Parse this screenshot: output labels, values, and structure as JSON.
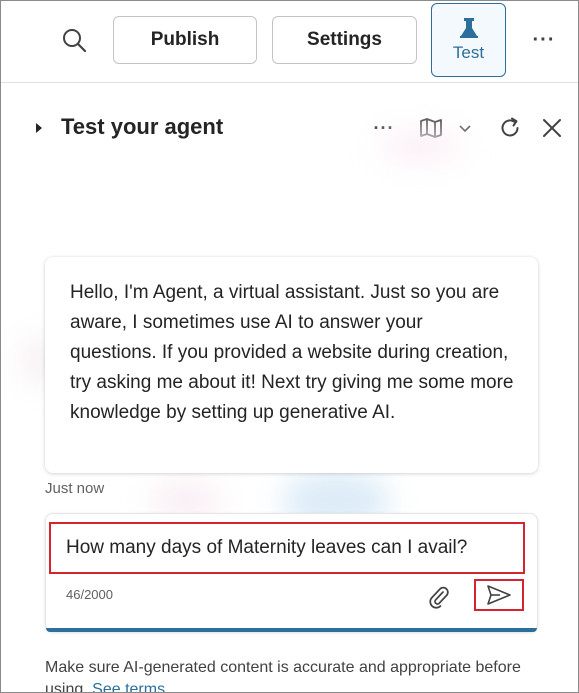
{
  "toolbar": {
    "publish_label": "Publish",
    "settings_label": "Settings",
    "test_label": "Test",
    "search_icon": "search-icon",
    "more_label": "···"
  },
  "panel": {
    "title": "Test your agent",
    "more_label": "···"
  },
  "chat": {
    "bot_message": "Hello, I'm Agent, a virtual assistant. Just so you are aware, I sometimes use AI to answer your questions. If you provided a website during creation, try asking me about it! Next try giving me some more knowledge by setting up generative AI.",
    "timestamp": "Just now"
  },
  "composer": {
    "input_value": "How many days of Maternity leaves can I avail?",
    "char_count": "46/2000"
  },
  "disclaimer": {
    "text": "Make sure AI-generated content is accurate and appropriate before using.",
    "link_label": "See terms"
  },
  "colors": {
    "accent": "#2b6f9a",
    "highlight_red": "#d3242f"
  }
}
